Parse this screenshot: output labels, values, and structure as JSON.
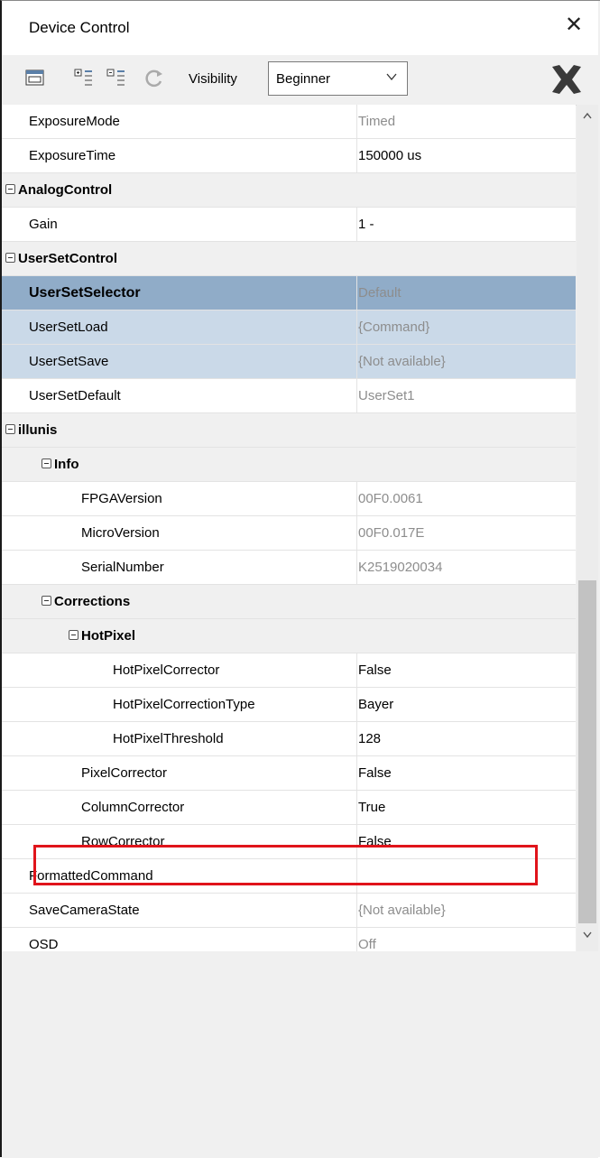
{
  "window": {
    "title": "Device Control"
  },
  "toolbar": {
    "visibility_label": "Visibility",
    "visibility_value": "Beginner",
    "icons": [
      "properties-icon",
      "expand-all-icon",
      "collapse-all-icon",
      "refresh-icon",
      "disconnect-icon"
    ]
  },
  "rows": [
    {
      "name": "ExposureMode",
      "value": "Timed",
      "type": "property",
      "readonly": true
    },
    {
      "name": "ExposureTime",
      "value": "150000 us",
      "type": "property",
      "readonly": false
    },
    {
      "name": "AnalogControl",
      "type": "category"
    },
    {
      "name": "Gain",
      "value": "1 -",
      "type": "property",
      "readonly": false
    },
    {
      "name": "UserSetControl",
      "type": "category"
    },
    {
      "name": "UserSetSelector",
      "value": "Default",
      "type": "property",
      "readonly": true,
      "selected": "primary"
    },
    {
      "name": "UserSetLoad",
      "value": "{Command}",
      "type": "property",
      "readonly": true,
      "selected": "secondary"
    },
    {
      "name": "UserSetSave",
      "value": "{Not available}",
      "type": "property",
      "readonly": true,
      "selected": "secondary"
    },
    {
      "name": "UserSetDefault",
      "value": "UserSet1",
      "type": "property",
      "readonly": true
    },
    {
      "name": "illunis",
      "type": "category"
    },
    {
      "name": "Info",
      "type": "category"
    },
    {
      "name": "FPGAVersion",
      "value": "00F0.0061",
      "type": "property",
      "readonly": true
    },
    {
      "name": "MicroVersion",
      "value": "00F0.017E",
      "type": "property",
      "readonly": true
    },
    {
      "name": "SerialNumber",
      "value": "K2519020034",
      "type": "property",
      "readonly": true
    },
    {
      "name": "Corrections",
      "type": "category"
    },
    {
      "name": "HotPixel",
      "type": "category"
    },
    {
      "name": "HotPixelCorrector",
      "value": "False",
      "type": "property",
      "readonly": false
    },
    {
      "name": "HotPixelCorrectionType",
      "value": "Bayer",
      "type": "property",
      "readonly": false
    },
    {
      "name": "HotPixelThreshold",
      "value": "128",
      "type": "property",
      "readonly": false
    },
    {
      "name": "PixelCorrector",
      "value": "False",
      "type": "property",
      "readonly": false
    },
    {
      "name": "ColumnCorrector",
      "value": "True",
      "type": "property",
      "readonly": false
    },
    {
      "name": "RowCorrector",
      "value": "False",
      "type": "property",
      "readonly": false
    },
    {
      "name": "FormattedCommand",
      "value": "",
      "type": "property",
      "readonly": false
    },
    {
      "name": "SaveCameraState",
      "value": "{Not available}",
      "type": "property",
      "readonly": true
    },
    {
      "name": "OSD",
      "value": "Off",
      "type": "property",
      "readonly": true
    }
  ],
  "colors": {
    "selected_primary": "#90acc8",
    "selected_secondary": "#cad9e8",
    "highlight": "#e0141b"
  }
}
